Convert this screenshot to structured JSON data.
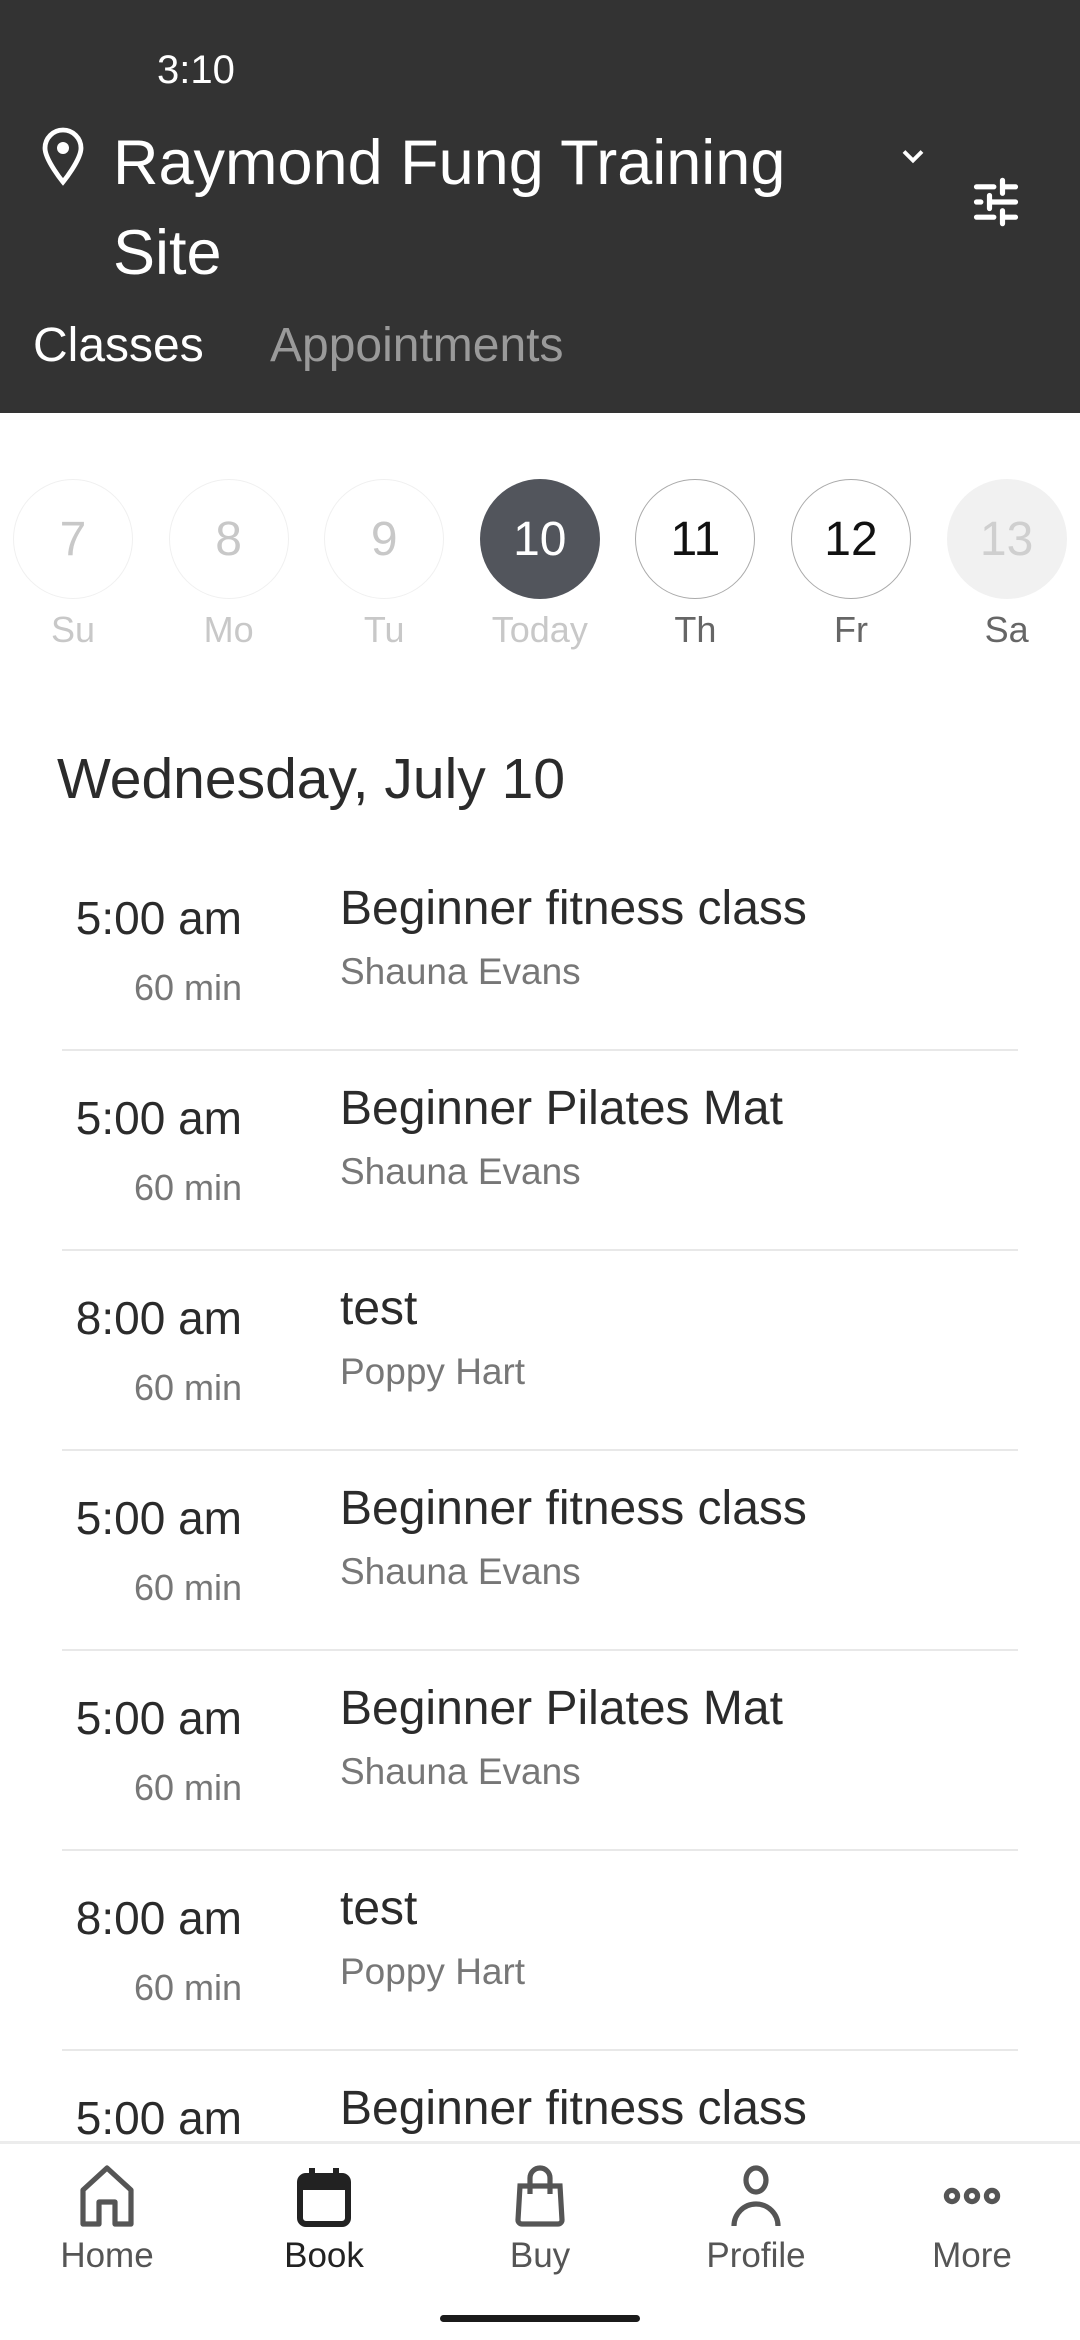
{
  "status": {
    "time": "3:10"
  },
  "header": {
    "site_name": "Raymond Fung Training Site",
    "tabs": [
      {
        "label": "Classes",
        "active": true
      },
      {
        "label": "Appointments",
        "active": false
      }
    ]
  },
  "dates": [
    {
      "num": "7",
      "label": "Su",
      "state": "past"
    },
    {
      "num": "8",
      "label": "Mo",
      "state": "past"
    },
    {
      "num": "9",
      "label": "Tu",
      "state": "past"
    },
    {
      "num": "10",
      "label": "Today",
      "state": "today"
    },
    {
      "num": "11",
      "label": "Th",
      "state": "future"
    },
    {
      "num": "12",
      "label": "Fr",
      "state": "future"
    },
    {
      "num": "13",
      "label": "Sa",
      "state": "unavail"
    }
  ],
  "day_heading": "Wednesday, July 10",
  "classes": [
    {
      "time": "5:00 am",
      "duration": "60 min",
      "title": "Beginner fitness class",
      "instructor": "Shauna Evans"
    },
    {
      "time": "5:00 am",
      "duration": "60 min",
      "title": "Beginner Pilates Mat",
      "instructor": "Shauna Evans"
    },
    {
      "time": "8:00 am",
      "duration": "60 min",
      "title": "test",
      "instructor": "Poppy Hart"
    },
    {
      "time": "5:00 am",
      "duration": "60 min",
      "title": "Beginner fitness class",
      "instructor": "Shauna Evans"
    },
    {
      "time": "5:00 am",
      "duration": "60 min",
      "title": "Beginner Pilates Mat",
      "instructor": "Shauna Evans"
    },
    {
      "time": "8:00 am",
      "duration": "60 min",
      "title": "test",
      "instructor": "Poppy Hart"
    },
    {
      "time": "5:00 am",
      "duration": "",
      "title": "Beginner fitness class",
      "instructor": ""
    }
  ],
  "nav": [
    {
      "label": "Home",
      "icon": "home-icon"
    },
    {
      "label": "Book",
      "icon": "calendar-icon",
      "active": true
    },
    {
      "label": "Buy",
      "icon": "shopping-bag-icon"
    },
    {
      "label": "Profile",
      "icon": "person-icon"
    },
    {
      "label": "More",
      "icon": "more-horizontal-icon"
    }
  ],
  "colors": {
    "header_bg": "#333333",
    "today_circle": "#52555c"
  }
}
